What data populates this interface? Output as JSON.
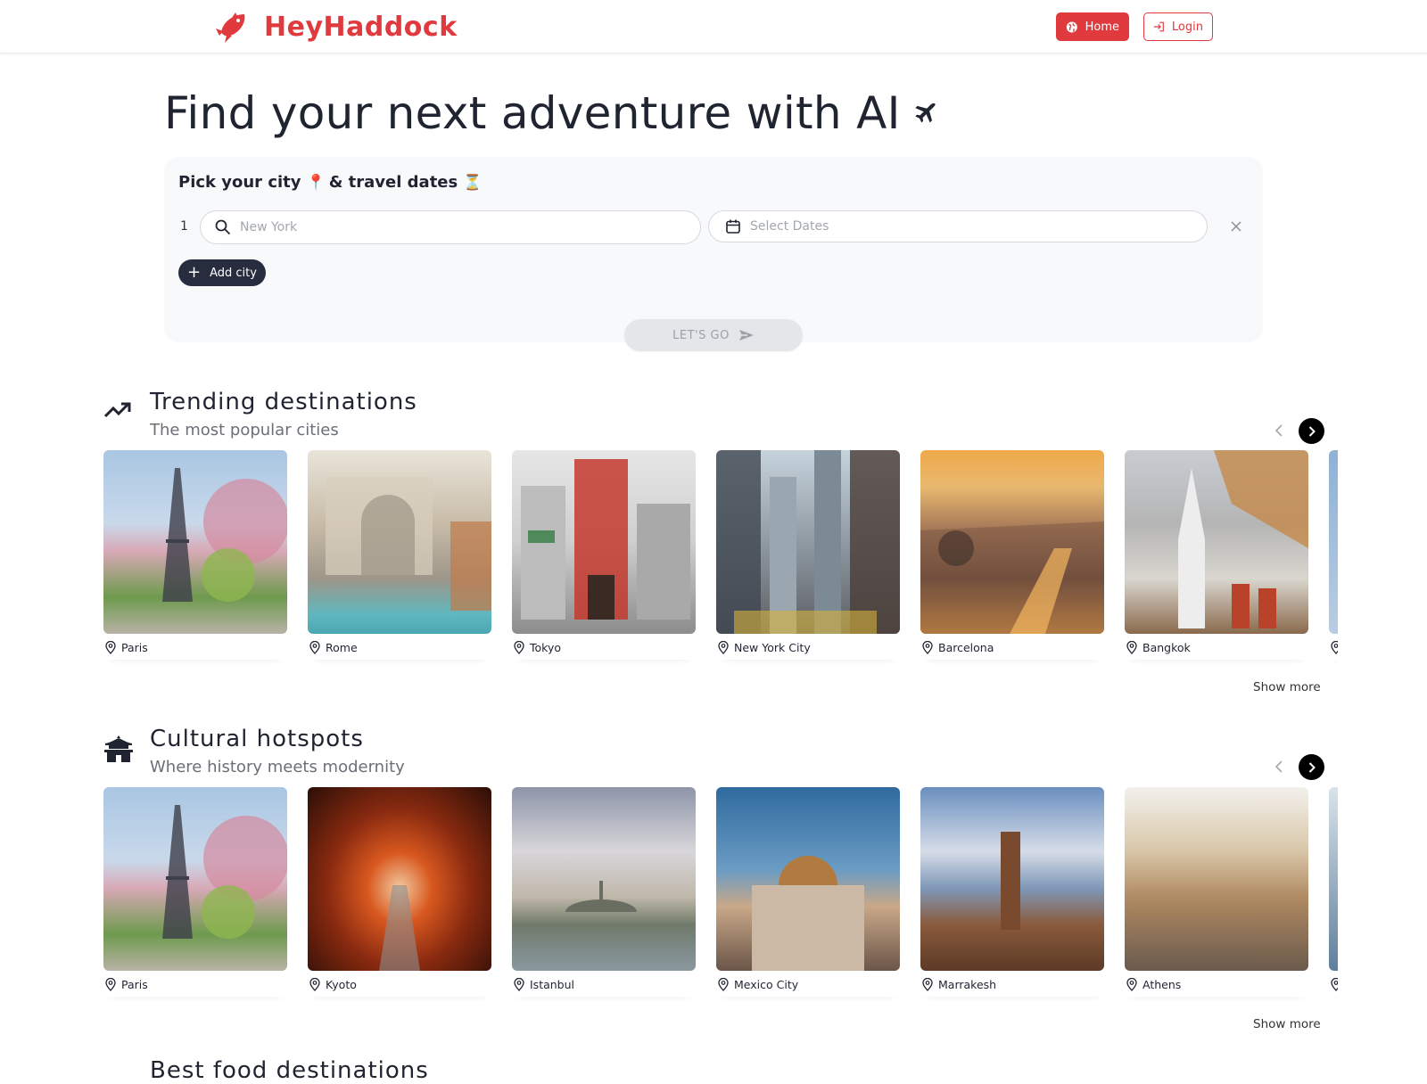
{
  "header": {
    "brand": "HeyHaddock",
    "brand_color": "#e0393e",
    "nav": {
      "home_label": "Home",
      "login_label": "Login"
    }
  },
  "hero": {
    "title": "Find your next adventure with AI"
  },
  "search": {
    "heading_part1": "Pick your city",
    "heading_emoji1": "📍",
    "heading_part2": "& travel dates",
    "heading_emoji2": "⏳",
    "row_number": "1",
    "city_placeholder": "New York",
    "city_value": "",
    "dates_placeholder": "Select Dates",
    "dates_value": "",
    "add_city_label": "Add city",
    "submit_label": "LET'S GO"
  },
  "sections": [
    {
      "title": "Trending destinations",
      "subtitle": "The most popular cities",
      "icon": "trending-up-icon",
      "cities": [
        "Paris",
        "Rome",
        "Tokyo",
        "New York City",
        "Barcelona",
        "Bangkok"
      ],
      "show_more_label": "Show more"
    },
    {
      "title": "Cultural hotspots",
      "subtitle": "Where history meets modernity",
      "icon": "pagoda-icon",
      "cities": [
        "Paris",
        "Kyoto",
        "Istanbul",
        "Mexico City",
        "Marrakesh",
        "Athens"
      ],
      "show_more_label": "Show more"
    }
  ],
  "next_section_title": "Best food destinations"
}
